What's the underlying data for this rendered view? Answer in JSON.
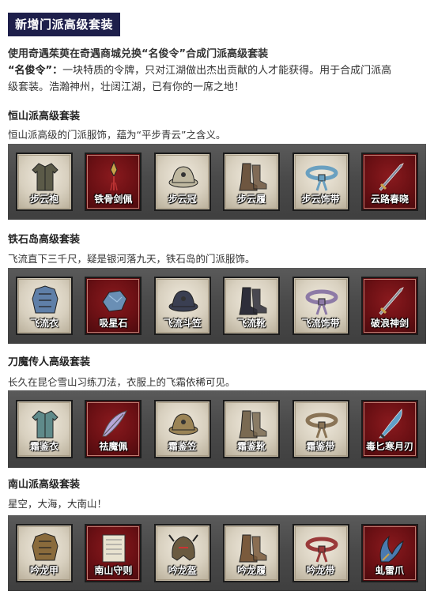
{
  "header": {
    "title": "新增门派高级套装"
  },
  "intro": {
    "line1": "使用奇遇茱萸在奇遇商城兑换“名俊令”合成门派高级套装",
    "term": "“名俊令”：",
    "desc_part1": "一块特质的令牌，只对江湖做出杰出贡献的人才能获得。用于合成门派高",
    "desc_part2": "级套装。浩瀚神州，壮阔江湖，已有你的一席之地！"
  },
  "sets": [
    {
      "title": "恒山派高级套装",
      "desc": "恒山派高级的门派服饰，蕴为“平步青云”之含义。",
      "items": [
        {
          "label": "步云袍",
          "icon": "robe-icon",
          "color": "#5b5a48"
        },
        {
          "label": "铁骨剑佩",
          "icon": "sword-pendant-icon",
          "color": "#c9a24a"
        },
        {
          "label": "步云冠",
          "icon": "hat-icon",
          "color": "#bfb8a0"
        },
        {
          "label": "步云履",
          "icon": "boots-icon",
          "color": "#6e5640"
        },
        {
          "label": "步云饰带",
          "icon": "belt-icon",
          "color": "#6aa0c0"
        },
        {
          "label": "云路春晓",
          "icon": "sword-icon",
          "color": "#7f8aa0"
        }
      ]
    },
    {
      "title": "铁石岛高级套装",
      "desc": "飞流直下三千尺，疑是银河落九天，铁石岛的门派服饰。",
      "items": [
        {
          "label": "飞流衣",
          "icon": "armor-icon",
          "color": "#5f7fa8"
        },
        {
          "label": "吸星石",
          "icon": "stone-icon",
          "color": "#6a8fb5"
        },
        {
          "label": "飞流斗笠",
          "icon": "hat-icon",
          "color": "#3a3f52"
        },
        {
          "label": "飞流靴",
          "icon": "boots-icon",
          "color": "#2e2e3a"
        },
        {
          "label": "飞流饰带",
          "icon": "belt-icon",
          "color": "#8d7aa6"
        },
        {
          "label": "破浪神剑",
          "icon": "sword-icon",
          "color": "#8a8f97"
        }
      ]
    },
    {
      "title": "刀魔传人高级套装",
      "desc": "长久在昆仑雪山习练刀法，衣服上的飞霜依稀可见。",
      "items": [
        {
          "label": "霜鉴衣",
          "icon": "robe-icon",
          "color": "#5f8a8a"
        },
        {
          "label": "祛魔佩",
          "icon": "feather-pendant-icon",
          "color": "#b7a6d8"
        },
        {
          "label": "霜鉴笠",
          "icon": "hat-icon",
          "color": "#9b8456"
        },
        {
          "label": "霜鉴靴",
          "icon": "boots-icon",
          "color": "#7a6a52"
        },
        {
          "label": "霜鉴带",
          "icon": "belt-icon",
          "color": "#8a7456"
        },
        {
          "label": "毒匕寒月刃",
          "icon": "blade-icon",
          "color": "#5fa0c8"
        }
      ]
    },
    {
      "title": "南山派高级套装",
      "desc": "星空，大海，大南山！",
      "items": [
        {
          "label": "吟龙甲",
          "icon": "armor-icon",
          "color": "#8a6b3c"
        },
        {
          "label": "南山守则",
          "icon": "scroll-icon",
          "color": "#e8e2cf"
        },
        {
          "label": "吟龙盔",
          "icon": "helmet-icon",
          "color": "#6a5a40"
        },
        {
          "label": "吟龙履",
          "icon": "boots-icon",
          "color": "#7a5a3c"
        },
        {
          "label": "吟龙带",
          "icon": "belt-icon",
          "color": "#9a3a3a"
        },
        {
          "label": "虬雷爪",
          "icon": "claw-icon",
          "color": "#4a7ab0"
        }
      ]
    }
  ]
}
